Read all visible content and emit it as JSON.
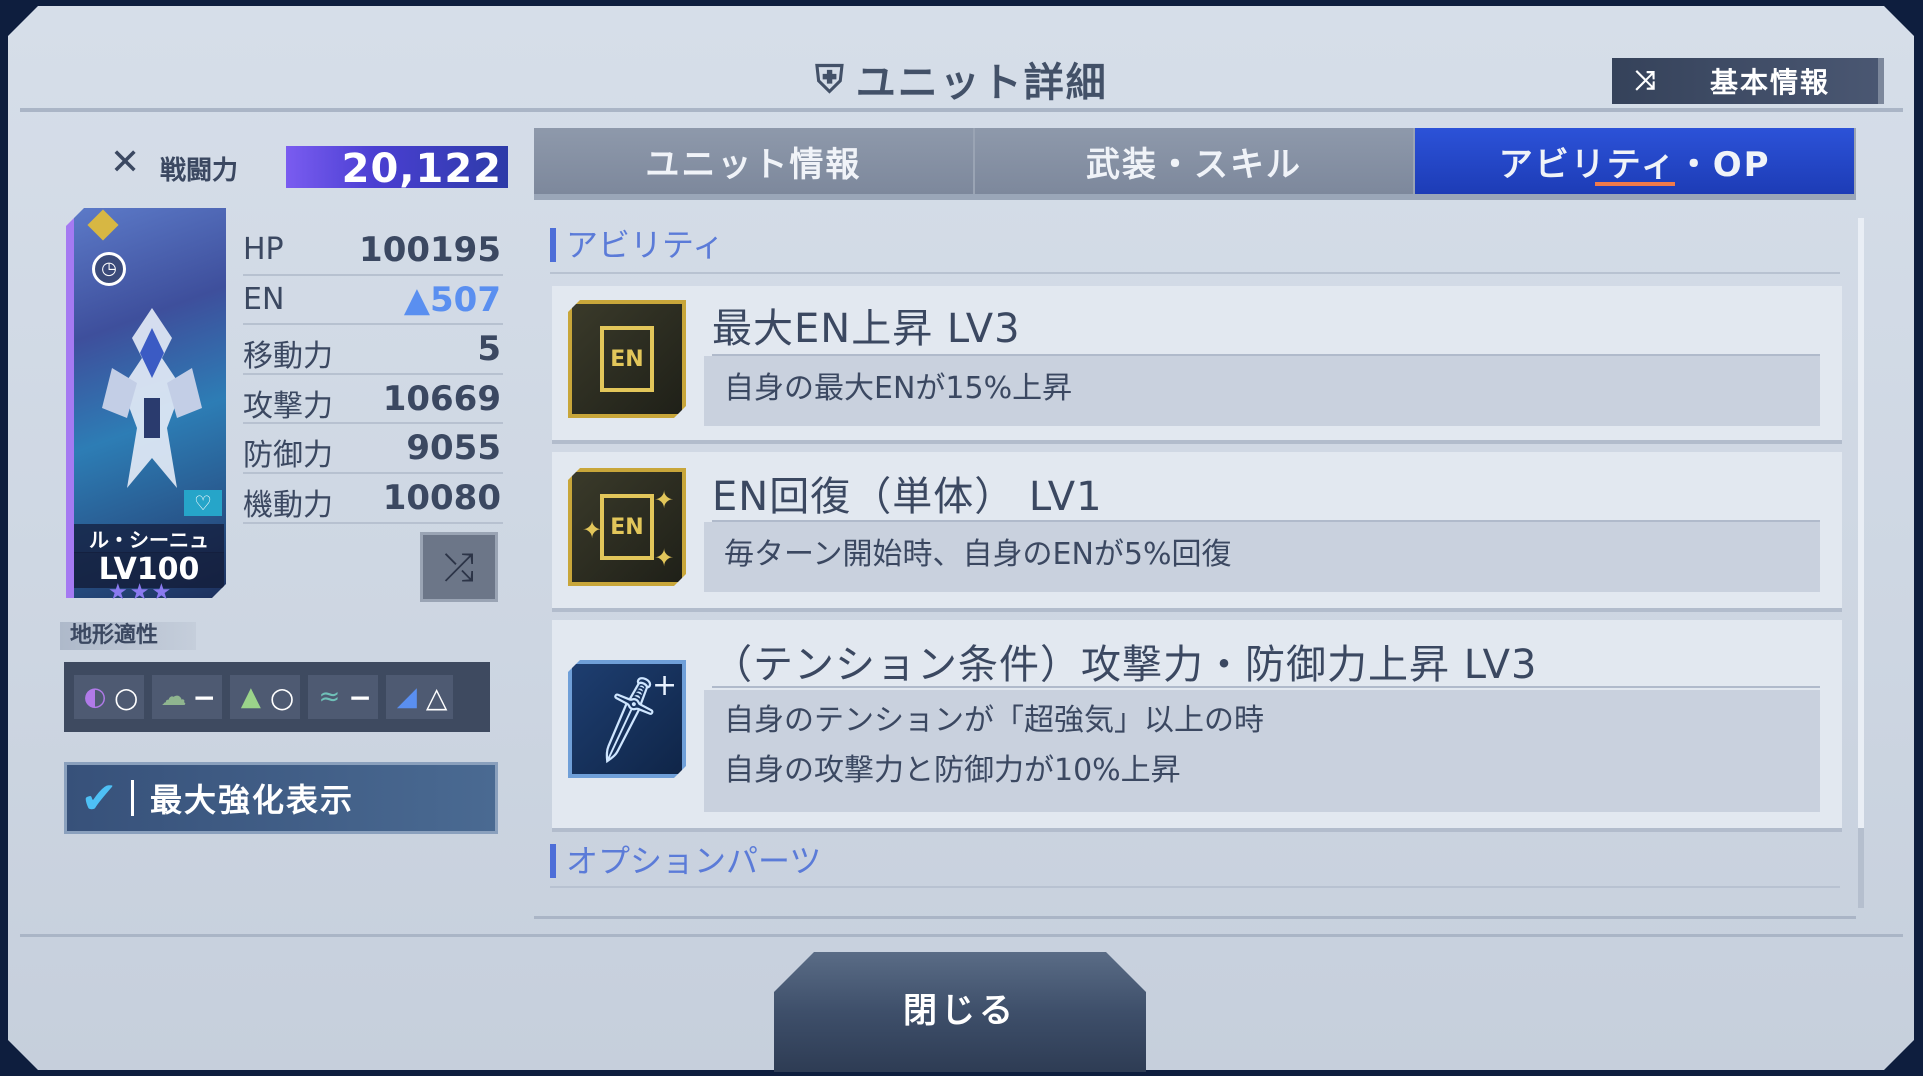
{
  "header": {
    "title": "ユニット詳細",
    "basic_info_button": "基本情報"
  },
  "unit": {
    "power_label": "戦闘力",
    "power_value": "20,122",
    "name": "ル・シーニュ",
    "level": "LV100",
    "stars": "★★★",
    "stats": [
      {
        "label": "HP",
        "value": "100195"
      },
      {
        "label": "EN",
        "value": "▲507"
      },
      {
        "label": "移動力",
        "value": "5"
      },
      {
        "label": "攻撃力",
        "value": "10669"
      },
      {
        "label": "防御力",
        "value": "9055"
      },
      {
        "label": "機動力",
        "value": "10080"
      }
    ],
    "terrain_label": "地形適性",
    "terrain": [
      {
        "icon": "space-icon",
        "value": "○"
      },
      {
        "icon": "air-icon",
        "value": "−"
      },
      {
        "icon": "land-icon",
        "value": "○"
      },
      {
        "icon": "water-icon",
        "value": "−"
      },
      {
        "icon": "underground-icon",
        "value": "△"
      }
    ],
    "max_enhance_label": "最大強化表示"
  },
  "tabs": [
    {
      "label": "ユニット情報",
      "active": false
    },
    {
      "label": "武装・スキル",
      "active": false
    },
    {
      "label": "アビリティ・OP",
      "active": true
    }
  ],
  "abilities": {
    "section_title": "アビリティ",
    "items": [
      {
        "icon": "en-max-icon",
        "title": "最大EN上昇 LV3",
        "desc": [
          "自身の最大ENが15%上昇"
        ]
      },
      {
        "icon": "en-recover-icon",
        "title": "EN回復（単体） LV1",
        "desc": [
          "毎ターン開始時、自身のENが5%回復"
        ]
      },
      {
        "icon": "sword-plus-icon",
        "title": "（テンション条件）攻撃力・防御力上昇 LV3",
        "desc": [
          "自身のテンションが「超強気」以上の時",
          "自身の攻撃力と防御力が10%上昇"
        ]
      }
    ]
  },
  "options": {
    "section_title": "オプションパーツ"
  },
  "footer": {
    "close_label": "閉じる"
  }
}
